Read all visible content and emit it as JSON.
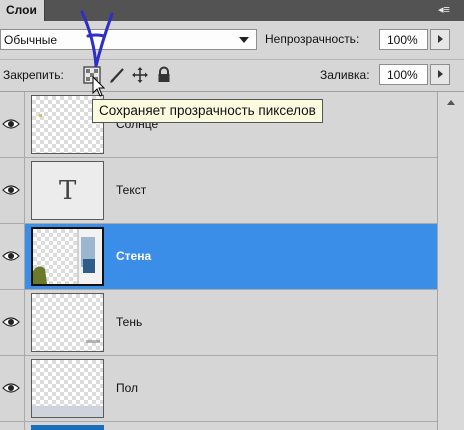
{
  "panel": {
    "tab_title": "Слои",
    "menu_icon": "panel-menu-icon"
  },
  "blend_mode": {
    "value": "Обычные"
  },
  "opacity": {
    "label": "Непрозрачность:",
    "value": "100%"
  },
  "lock": {
    "label": "Закрепить:"
  },
  "fill": {
    "label": "Заливка:",
    "value": "100%"
  },
  "tooltip": {
    "text": "Сохраняет прозрачность пикселов"
  },
  "layers": [
    {
      "name": "Солнце",
      "thumb": "transparent",
      "selected": false
    },
    {
      "name": "Текст",
      "thumb": "text-layer",
      "thumb_glyph": "T",
      "selected": false
    },
    {
      "name": "Стена",
      "thumb": "image",
      "selected": true
    },
    {
      "name": "Тень",
      "thumb": "transparent",
      "selected": false
    },
    {
      "name": "Пол",
      "thumb": "transparent",
      "selected": false
    }
  ],
  "colors": {
    "selection": "#3b8ee8",
    "annotation": "#2e2ec8",
    "tooltip_bg": "#fbfbdf"
  }
}
